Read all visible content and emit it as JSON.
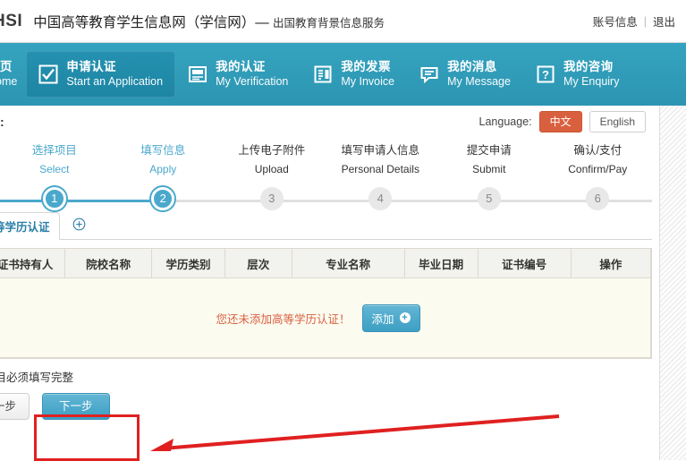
{
  "header": {
    "logo_text": "HSI",
    "title_cn": "中国高等教育学生信息网（学信网）—",
    "title_sub": "出国教育背景信息服务",
    "account_label": "账号信息",
    "divider": "|",
    "logout_label": "退出"
  },
  "nav": {
    "items": [
      {
        "cn": "首页",
        "en": "Home",
        "icon": "home-icon",
        "active": false
      },
      {
        "cn": "申请认证",
        "en": "Start an Application",
        "icon": "checkbox-icon",
        "active": true
      },
      {
        "cn": "我的认证",
        "en": "My Verification",
        "icon": "certificate-icon",
        "active": false
      },
      {
        "cn": "我的发票",
        "en": "My Invoice",
        "icon": "invoice-icon",
        "active": false
      },
      {
        "cn": "我的消息",
        "en": "My Message",
        "icon": "message-icon",
        "active": false
      },
      {
        "cn": "我的咨询",
        "en": "My Enquiry",
        "icon": "question-icon",
        "active": false
      }
    ]
  },
  "process": {
    "title": "程:",
    "language_label": "Language:",
    "lang_zh": "中文",
    "lang_en": "English",
    "lang_active": "zh",
    "accent_color": "#d9603f"
  },
  "stepper": {
    "active_step": 2,
    "step_color_done": "#4aa8cc",
    "steps": [
      {
        "num": "1",
        "cn": "选择项目",
        "en": "Select",
        "done": true
      },
      {
        "num": "2",
        "cn": "填写信息",
        "en": "Apply",
        "done": true
      },
      {
        "num": "3",
        "cn": "上传电子附件",
        "en": "Upload",
        "done": false
      },
      {
        "num": "4",
        "cn": "填写申请人信息",
        "en": "Personal Details",
        "done": false
      },
      {
        "num": "5",
        "cn": "提交申请",
        "en": "Submit",
        "done": false
      },
      {
        "num": "6",
        "cn": "确认/支付",
        "en": "Confirm/Pay",
        "done": false
      }
    ]
  },
  "tabs": {
    "items": [
      {
        "label": "等学历认证",
        "active": true
      }
    ],
    "add_icon": "plus-circle-icon"
  },
  "table": {
    "columns": [
      "证书持有人",
      "院校名称",
      "学历类别",
      "层次",
      "专业名称",
      "毕业日期",
      "证书编号",
      "操作"
    ],
    "rows": [],
    "empty_message": "您还未添加高等学历认证！",
    "add_button_label": "添加",
    "add_button_icon": "plus-icon"
  },
  "footer": {
    "hint": "项目必须填写完整",
    "prev_label": "一步",
    "next_label": "下一步",
    "watermark": ""
  },
  "annotation": {
    "color": "#e02020",
    "shape": "box-with-arrow",
    "target": "next-button"
  }
}
